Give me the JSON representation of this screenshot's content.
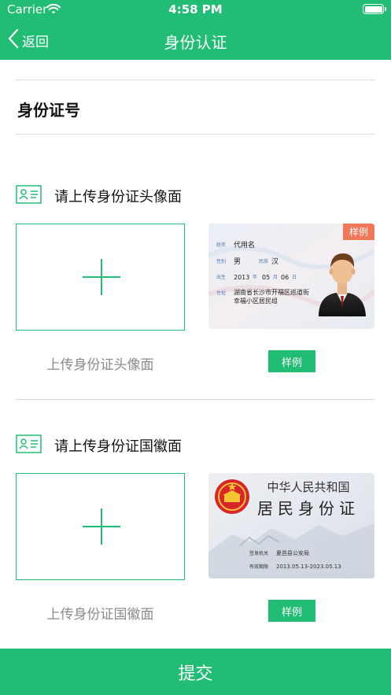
{
  "status_bar": {
    "carrier": "Carrier",
    "time": "4:58 PM"
  },
  "nav": {
    "back_label": "返回",
    "title": "身份认证"
  },
  "id_number": {
    "label": "身份证号"
  },
  "front": {
    "section_title": "请上传身份证头像面",
    "upload_caption": "上传身份证头像面",
    "sample_button": "样例",
    "sample_card": {
      "tag": "样例",
      "name_label": "姓名",
      "name": "代用名",
      "gender_label": "性别",
      "gender": "男",
      "ethnicity_label": "民族",
      "ethnicity": "汉",
      "birth_label": "出生",
      "birth_year": "2013",
      "birth_year_unit": "年",
      "birth_month": "05",
      "birth_month_unit": "月",
      "birth_day": "06",
      "birth_day_unit": "日",
      "address_label": "住址",
      "address_line1": "湖南省长沙市开福区巡道街",
      "address_line2": "幸福小区居民组"
    }
  },
  "back": {
    "section_title": "请上传身份证国徽面",
    "upload_caption": "上传身份证国徽面",
    "sample_button": "样例",
    "sample_card": {
      "country": "中华人民共和国",
      "card_title": "居民身份证",
      "authority_label": "签发机关",
      "authority": "夏邑县公安局",
      "validity_label": "有效期限",
      "validity": "2013.05.13-2023.05.13"
    }
  },
  "submit_label": "提交",
  "colors": {
    "accent": "#22bd74",
    "sample_tag": "#f0775a",
    "emblem_red": "#d8242a"
  }
}
